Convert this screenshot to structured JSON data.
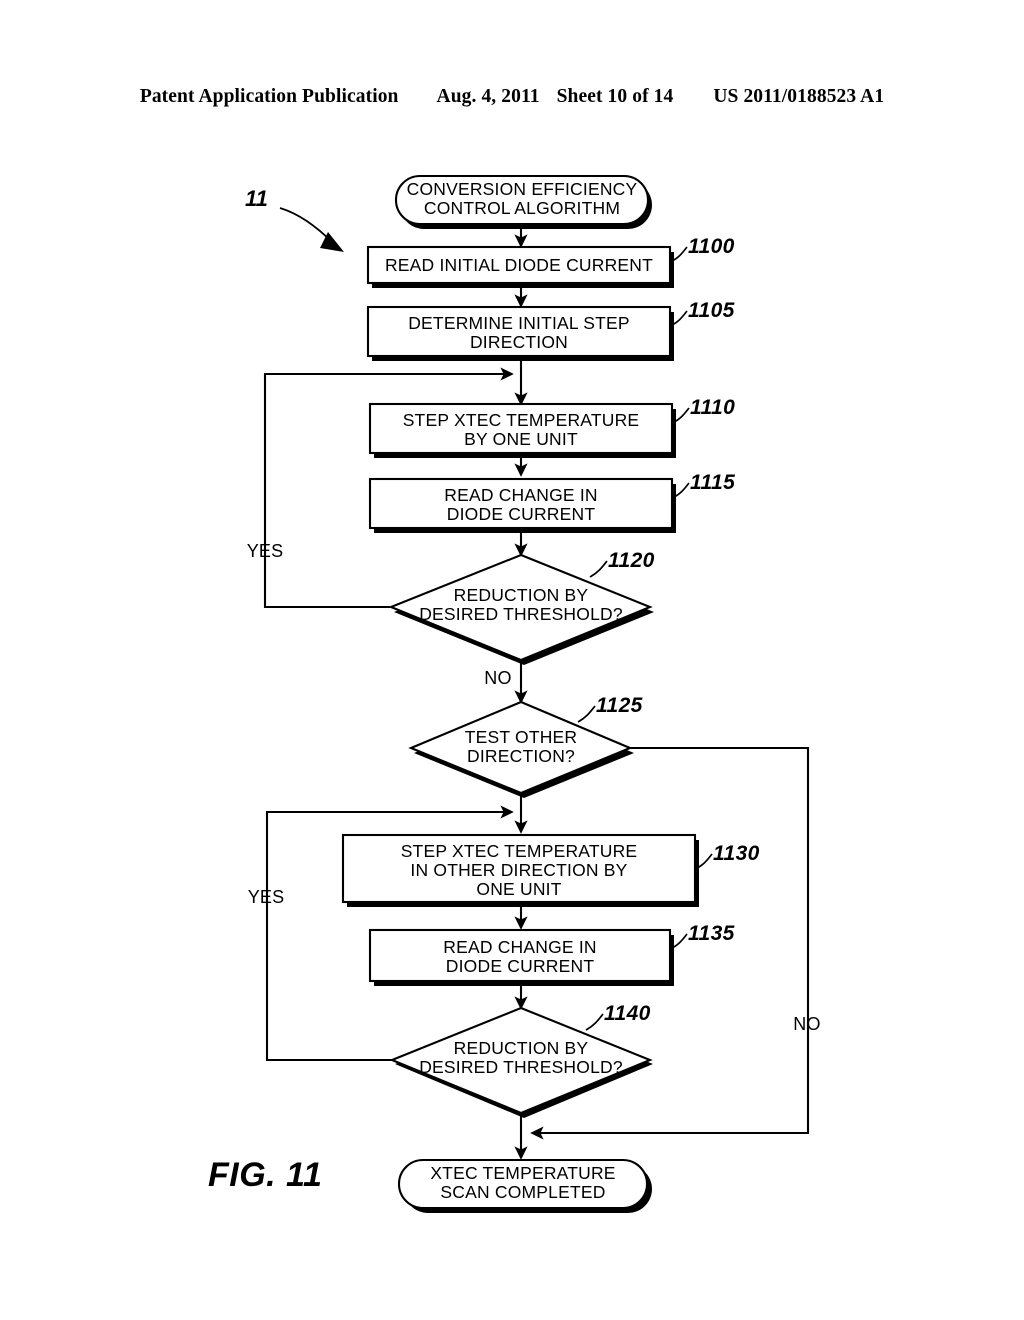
{
  "header": {
    "publication": "Patent Application Publication",
    "date": "Aug. 4, 2011",
    "sheet": "Sheet 10 of 14",
    "number": "US 2011/0188523 A1"
  },
  "figure": {
    "label": "FIG. 11",
    "diagram_reference": "11"
  },
  "flowchart": {
    "nodes": [
      {
        "id": "start",
        "shape": "terminator",
        "lines": [
          "CONVERSION EFFICIENCY",
          "CONTROL ALGORITHM"
        ],
        "ref": ""
      },
      {
        "id": "n1100",
        "shape": "process",
        "lines": [
          "READ INITIAL DIODE CURRENT"
        ],
        "ref": "1100"
      },
      {
        "id": "n1105",
        "shape": "process",
        "lines": [
          "DETERMINE INITIAL STEP",
          "DIRECTION"
        ],
        "ref": "1105"
      },
      {
        "id": "n1110",
        "shape": "process",
        "lines": [
          "STEP XTEC TEMPERATURE",
          "BY ONE UNIT"
        ],
        "ref": "1110"
      },
      {
        "id": "n1115",
        "shape": "process",
        "lines": [
          "READ CHANGE IN",
          "DIODE CURRENT"
        ],
        "ref": "1115"
      },
      {
        "id": "n1120",
        "shape": "decision",
        "lines": [
          "REDUCTION BY",
          "DESIRED THRESHOLD?"
        ],
        "ref": "1120"
      },
      {
        "id": "n1125",
        "shape": "decision",
        "lines": [
          "TEST OTHER",
          "DIRECTION?"
        ],
        "ref": "1125"
      },
      {
        "id": "n1130",
        "shape": "process",
        "lines": [
          "STEP XTEC TEMPERATURE",
          "IN OTHER DIRECTION BY",
          "ONE UNIT"
        ],
        "ref": "1130"
      },
      {
        "id": "n1135",
        "shape": "process",
        "lines": [
          "READ CHANGE IN",
          "DIODE CURRENT"
        ],
        "ref": "1135"
      },
      {
        "id": "n1140",
        "shape": "decision",
        "lines": [
          "REDUCTION BY",
          "DESIRED THRESHOLD?"
        ],
        "ref": "1140"
      },
      {
        "id": "end",
        "shape": "terminator",
        "lines": [
          "XTEC TEMPERATURE",
          "SCAN COMPLETED"
        ],
        "ref": ""
      }
    ],
    "branch_labels": {
      "yes_upper": "YES",
      "no_upper": "NO",
      "yes_lower": "YES",
      "no_lower": "NO"
    }
  },
  "colors": {
    "ink": "#000000",
    "paper": "#ffffff"
  }
}
